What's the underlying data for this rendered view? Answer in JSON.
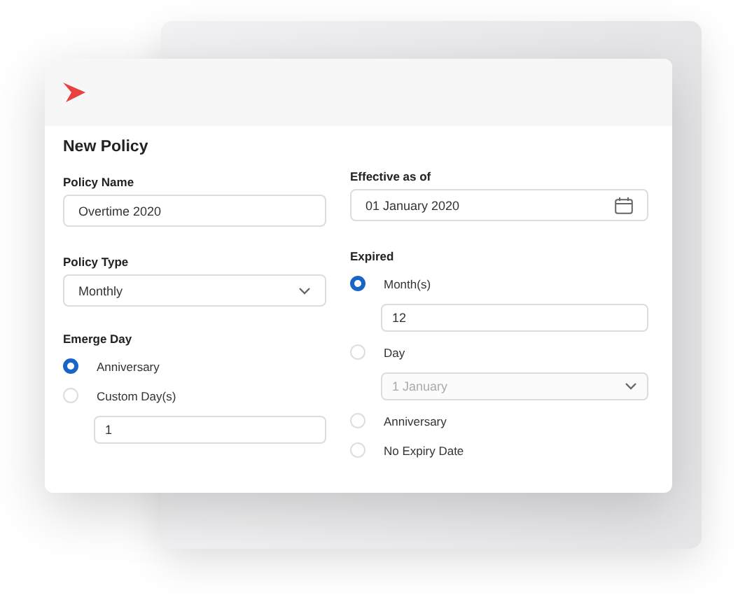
{
  "form": {
    "title": "New Policy",
    "policy_name": {
      "label": "Policy Name",
      "value": "Overtime 2020"
    },
    "policy_type": {
      "label": "Policy Type",
      "value": "Monthly"
    },
    "emerge_day": {
      "label": "Emerge Day",
      "options": [
        {
          "label": "Anniversary",
          "selected": true
        },
        {
          "label": "Custom Day(s)",
          "selected": false,
          "input": {
            "kind": "text",
            "value": "1",
            "disabled": false
          }
        }
      ]
    },
    "effective": {
      "label": "Effective as of",
      "value": "01 January 2020"
    },
    "expired": {
      "label": "Expired",
      "options": [
        {
          "label": "Month(s)",
          "selected": true,
          "input": {
            "kind": "text",
            "value": "12",
            "disabled": false
          }
        },
        {
          "label": "Day",
          "selected": false,
          "input": {
            "kind": "select",
            "value": "1 January",
            "disabled": true
          }
        },
        {
          "label": "Anniversary",
          "selected": false
        },
        {
          "label": "No Expiry Date",
          "selected": false
        }
      ]
    }
  }
}
